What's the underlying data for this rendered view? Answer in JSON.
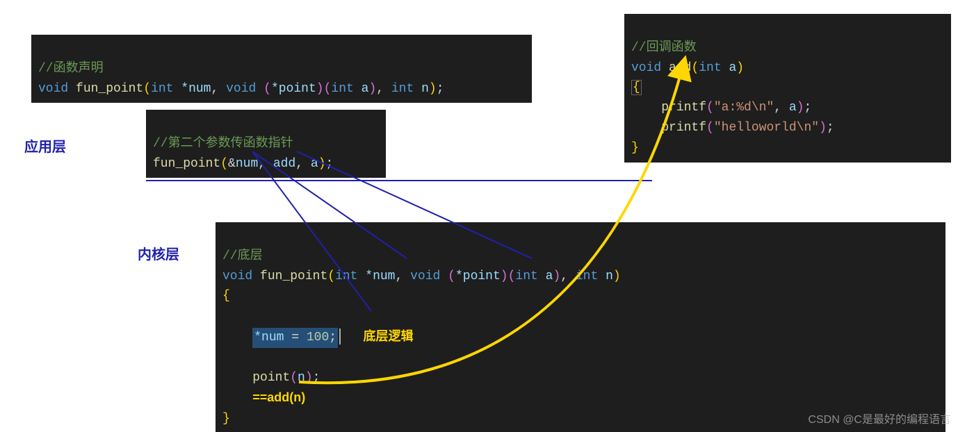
{
  "labels": {
    "app_layer": "应用层",
    "kernel_layer": "内核层"
  },
  "block1": {
    "comment": "//函数声明",
    "kw_void": "void",
    "fn": "fun_point",
    "p_int": "int",
    "p_num": "*num",
    "p_void": "void",
    "p_point": "(*point)",
    "p_int2": "int",
    "p_a": "a",
    "p_int3": "int",
    "p_n": "n"
  },
  "block2": {
    "comment": "//第二个参数传函数指针",
    "fn": "fun_point",
    "amp": "&",
    "num": "num",
    "add": "add",
    "a": "a"
  },
  "block3": {
    "comment": "//回调函数",
    "kw_void": "void",
    "fn": "add",
    "p_int": "int",
    "p_a": "a",
    "printf": "printf",
    "str1": "\"a:%d\\n\"",
    "arg_a": "a",
    "str2": "\"helloworld\\n\""
  },
  "block4": {
    "comment": "//底层",
    "kw_void": "void",
    "fn": "fun_point",
    "p_int": "int",
    "p_num": "*num",
    "p_void": "void",
    "p_point": "(*point)",
    "p_int2": "int",
    "p_a": "a",
    "p_int3": "int",
    "p_n": "n",
    "sel_code": "*num = 100;",
    "annotation": "底层逻辑",
    "point_call_fn": "point",
    "point_call_arg": "n",
    "eq_add": "==add(n)"
  },
  "watermark": "CSDN @C是最好的编程语言"
}
